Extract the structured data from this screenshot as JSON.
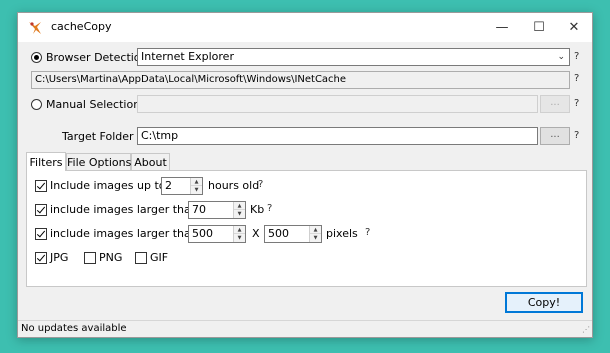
{
  "window": {
    "title": "cacheCopy",
    "minimize": "—",
    "maximize": "☐",
    "close": "✕"
  },
  "browser_detection": {
    "label": "Browser Detection",
    "selected": "Internet Explorer",
    "path": "C:\\Users\\Martina\\AppData\\Local\\Microsoft\\Windows\\INetCache",
    "help": "?"
  },
  "manual_selection": {
    "label": "Manual Selection",
    "value": "",
    "browse": "...",
    "help": "?"
  },
  "target_folder": {
    "label": "Target Folder",
    "value": "C:\\tmp",
    "browse": "...",
    "help": "?"
  },
  "tabs": [
    "Filters",
    "File Options",
    "About"
  ],
  "filters": {
    "row1": {
      "label": "Include images up to",
      "value": "2",
      "unit": "hours old",
      "help": "?"
    },
    "row2": {
      "label": "include images larger than",
      "value": "70",
      "unit": "Kb",
      "help": "?"
    },
    "row3": {
      "label": "include images larger than",
      "width": "500",
      "x": "X",
      "height": "500",
      "unit": "pixels",
      "help": "?"
    },
    "types": {
      "jpg": "JPG",
      "png": "PNG",
      "gif": "GIF"
    }
  },
  "copy_button": "Copy!",
  "status": "No updates available",
  "colors": {
    "background": "#3dbfb0",
    "accent": "#0078d7"
  }
}
